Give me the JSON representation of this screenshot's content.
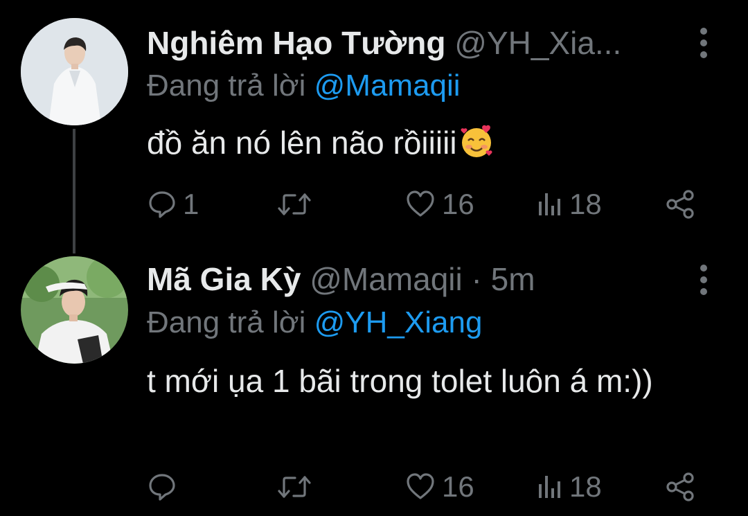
{
  "tweets": [
    {
      "display_name": "Nghiêm Hạo Tường",
      "handle": "@YH_Xia...",
      "timestamp": "",
      "replying_prefix": "Đang trả lời",
      "replying_to": "@Mamaqii",
      "text": "đồ ăn nó lên não rồiiiii",
      "emoji": "smiling-face-with-hearts",
      "reply_count": "1",
      "retweet_count": "",
      "like_count": "16",
      "view_count": "18"
    },
    {
      "display_name": "Mã Gia Kỳ",
      "handle": "@Mamaqii",
      "separator": "·",
      "timestamp": "5m",
      "replying_prefix": "Đang trả lời",
      "replying_to": "@YH_Xiang",
      "text": "t mới ụa 1 bãi trong tolet luôn á m:))",
      "reply_count": "",
      "retweet_count": "",
      "like_count": "16",
      "view_count": "18"
    }
  ],
  "colors": {
    "background": "#000000",
    "text": "#e7e9ea",
    "muted": "#71767b",
    "accent": "#1d9bf0",
    "thread_line": "#3e4144"
  },
  "icons": [
    "reply-icon",
    "retweet-icon",
    "like-icon",
    "views-icon",
    "share-icon",
    "more-icon"
  ]
}
